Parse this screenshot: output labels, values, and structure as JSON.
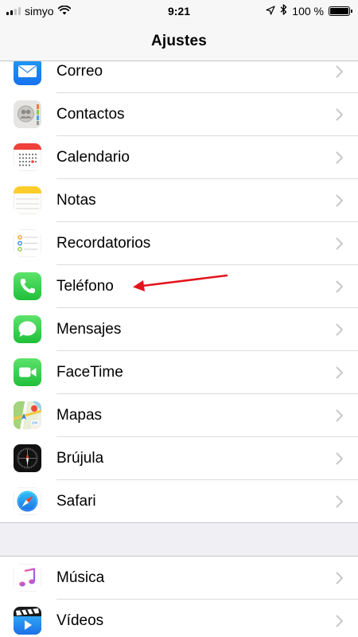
{
  "status_bar": {
    "carrier": "simyo",
    "time": "9:21",
    "battery_percent": "100 %",
    "battery_level": 1.0,
    "signal_bars_filled": 2,
    "signal_bars_total": 4
  },
  "nav": {
    "title": "Ajustes"
  },
  "settings_group_1": [
    {
      "label": "Correo",
      "icon": "mail-icon"
    },
    {
      "label": "Contactos",
      "icon": "contacts-icon"
    },
    {
      "label": "Calendario",
      "icon": "calendar-icon"
    },
    {
      "label": "Notas",
      "icon": "notes-icon"
    },
    {
      "label": "Recordatorios",
      "icon": "reminders-icon"
    },
    {
      "label": "Teléfono",
      "icon": "phone-icon"
    },
    {
      "label": "Mensajes",
      "icon": "messages-icon"
    },
    {
      "label": "FaceTime",
      "icon": "facetime-icon"
    },
    {
      "label": "Mapas",
      "icon": "maps-icon"
    },
    {
      "label": "Brújula",
      "icon": "compass-icon"
    },
    {
      "label": "Safari",
      "icon": "safari-icon"
    }
  ],
  "settings_group_2": [
    {
      "label": "Música",
      "icon": "music-icon"
    },
    {
      "label": "Vídeos",
      "icon": "videos-icon"
    }
  ],
  "annotation": {
    "type": "red-arrow",
    "points_to": "Teléfono",
    "color": "#e3141d"
  },
  "colors": {
    "background": "#efeff4",
    "bar_background": "#f7f7f7",
    "separator": "#c8c7cc",
    "chevron": "#c7c7cc",
    "arrow": "#e3141d"
  }
}
